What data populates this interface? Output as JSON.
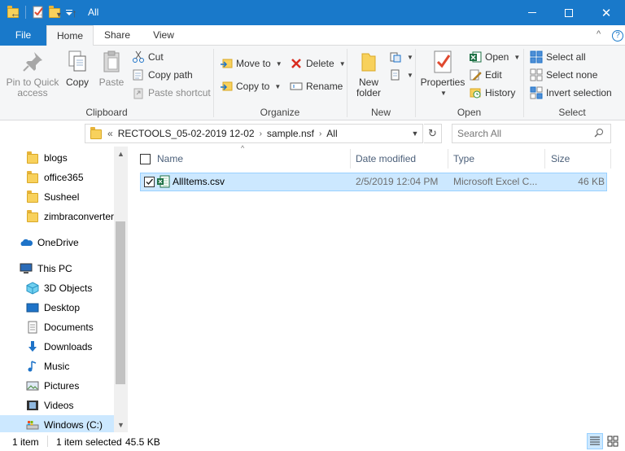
{
  "window": {
    "title": "All",
    "minimize_glyph": "—",
    "close_glyph": "✕"
  },
  "ribbon_tabs": {
    "file": "File",
    "home": "Home",
    "share": "Share",
    "view": "View",
    "collapse_glyph": "^",
    "help_glyph": "?"
  },
  "ribbon": {
    "clipboard": {
      "label": "Clipboard",
      "pin_line1": "Pin to Quick",
      "pin_line2": "access",
      "copy": "Copy",
      "paste": "Paste",
      "cut": "Cut",
      "copy_path": "Copy path",
      "paste_shortcut": "Paste shortcut"
    },
    "organize": {
      "label": "Organize",
      "move_to": "Move to",
      "copy_to": "Copy to",
      "delete": "Delete",
      "rename": "Rename"
    },
    "new": {
      "label": "New",
      "new_folder_line1": "New",
      "new_folder_line2": "folder"
    },
    "open": {
      "label": "Open",
      "properties": "Properties",
      "open": "Open",
      "edit": "Edit",
      "history": "History"
    },
    "select": {
      "label": "Select",
      "select_all": "Select all",
      "select_none": "Select none",
      "invert_selection": "Invert selection"
    }
  },
  "address_bar": {
    "overflow": "«",
    "segments": [
      "RECTOOLS_05-02-2019 12-02",
      "sample.nsf",
      "All"
    ],
    "separator": "›",
    "search_placeholder": "Search All"
  },
  "nav_pane": {
    "items": [
      {
        "label": "blogs",
        "icon": "folder-icon"
      },
      {
        "label": "office365",
        "icon": "folder-icon"
      },
      {
        "label": "Susheel",
        "icon": "folder-icon"
      },
      {
        "label": "zimbraconverter",
        "icon": "folder-icon"
      },
      {
        "label": "OneDrive",
        "icon": "onedrive-icon"
      },
      {
        "label": "This PC",
        "icon": "computer-icon"
      },
      {
        "label": "3D Objects",
        "icon": "3d-objects-icon"
      },
      {
        "label": "Desktop",
        "icon": "desktop-icon"
      },
      {
        "label": "Documents",
        "icon": "documents-icon"
      },
      {
        "label": "Downloads",
        "icon": "downloads-icon"
      },
      {
        "label": "Music",
        "icon": "music-icon"
      },
      {
        "label": "Pictures",
        "icon": "pictures-icon"
      },
      {
        "label": "Videos",
        "icon": "videos-icon"
      },
      {
        "label": "Windows (C:)",
        "icon": "drive-icon"
      }
    ]
  },
  "file_list": {
    "columns": {
      "name": "Name",
      "date_modified": "Date modified",
      "type": "Type",
      "size": "Size"
    },
    "rows": [
      {
        "name": "AllItems.csv",
        "date_modified": "2/5/2019 12:04 PM",
        "type": "Microsoft Excel C...",
        "size": "46 KB",
        "selected": true
      }
    ]
  },
  "status_bar": {
    "item_count": "1 item",
    "selection": "1 item selected",
    "selection_size": "45.5 KB"
  },
  "colors": {
    "titlebar": "#1979ca",
    "selection": "#cce8ff",
    "selection_border": "#99d1ff",
    "folder": "#f8d15c"
  }
}
